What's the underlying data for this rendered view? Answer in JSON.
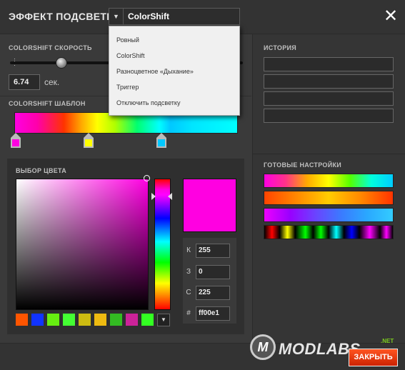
{
  "header": {
    "title": "ЭФФЕКТ ПОДСВЕТКИ",
    "effect_select_value": "ColorShift",
    "effect_select_arrow": "▼",
    "close_label": "✕"
  },
  "speed": {
    "label": "COLORSHIFT СКОРОСТЬ",
    "value": "6.74",
    "unit": "сек.",
    "slider_fraction": 0.22
  },
  "template": {
    "label": "COLORSHIFT ШАБЛОН",
    "stops": [
      {
        "color": "#ff00e1"
      },
      {
        "color": "#ffff00"
      },
      {
        "color": "#00c8ff"
      }
    ]
  },
  "picker": {
    "label": "ВЫБОР ЦВЕТА",
    "preview_color": "#ff00e1",
    "fields": [
      {
        "label": "К",
        "value": "255"
      },
      {
        "label": "З",
        "value": "0"
      },
      {
        "label": "С",
        "value": "225"
      },
      {
        "label": "#",
        "value": "ff00e1"
      }
    ],
    "swatches": [
      "#ff5500",
      "#1133ff",
      "#66ee11",
      "#44ff33",
      "#ccbb11",
      "#eebb11",
      "#33bb22",
      "#cc2299",
      "#33ff22"
    ],
    "more_arrow": "▼"
  },
  "history": {
    "label": "ИСТОРИЯ",
    "slot_count": 4
  },
  "presets": {
    "label": "ГОТОВЫЕ НАСТРОЙКИ",
    "count": 4
  },
  "dropdown": {
    "items": [
      "Ровный",
      "ColorShift",
      "Разноцветное «Дыхание»",
      "Триггер",
      "Отключить подсветку"
    ]
  },
  "footer": {
    "logo_m": "M",
    "logo_text": "MODLABS",
    "logo_net": ".NET",
    "apply_label": "ЗАКРЫТЬ"
  }
}
